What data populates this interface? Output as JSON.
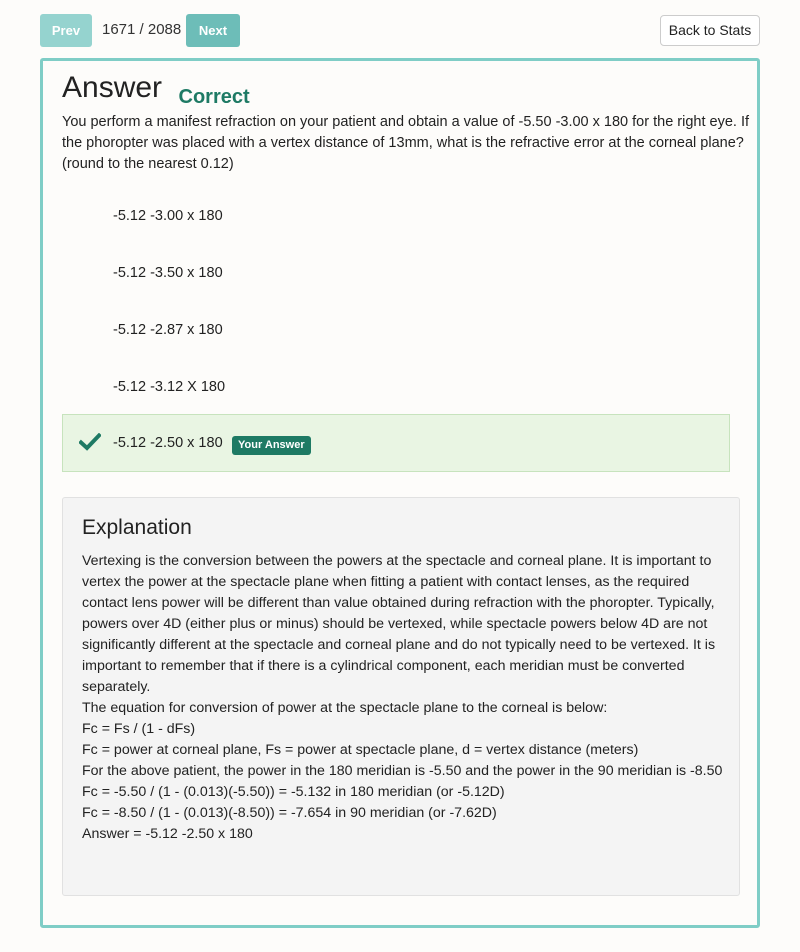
{
  "nav": {
    "prev_label": "Prev",
    "counter": "1671 / 2088",
    "next_label": "Next",
    "back_label": "Back to Stats"
  },
  "card": {
    "title": "Answer",
    "status": "Correct",
    "status_color": "#1e7a64",
    "border_color": "#7fcdc6",
    "question": "You perform a manifest refraction on your patient and obtain a value of -5.50 -3.00 x 180 for the right eye. If the phoropter was placed with a vertex distance of 13mm, what is the refractive error at the corneal plane? (round to the nearest 0.12)",
    "options": [
      "-5.12 -3.00 x 180",
      "-5.12 -3.50 x 180",
      "-5.12 -2.87 x 180",
      "-5.12 -3.12 X 180"
    ],
    "selected_option": "-5.12 -2.50 x 180",
    "selected_icon": "checkmark-icon",
    "your_answer_badge": "Your Answer"
  },
  "explanation": {
    "title": "Explanation",
    "lines": [
      "Vertexing is the conversion between the powers at the spectacle and corneal plane. It is important to vertex the power at the spectacle plane when fitting a patient with contact lenses, as the required contact lens power will be different than value obtained during refraction with the phoropter. Typically, powers over 4D (either plus or minus) should be vertexed, while spectacle powers below 4D are not significantly different at the spectacle and corneal plane and do not typically need to be vertexed. It is important to remember that if there is a cylindrical component, each meridian must be converted separately.",
      "The equation for conversion of power at the spectacle plane to the corneal is below:",
      "Fc = Fs / (1 - dFs)",
      "Fc = power at corneal plane, Fs = power at spectacle plane, d = vertex distance (meters)",
      "For the above patient, the power in the 180 meridian is -5.50 and the power in the 90 meridian is -8.50",
      "Fc = -5.50 / (1 - (0.013)(-5.50)) = -5.132 in 180 meridian (or -5.12D)",
      "Fc = -8.50 / (1 - (0.013)(-8.50)) = -7.654 in 90 meridian (or -7.62D)",
      "Answer = -5.12 -2.50 x 180"
    ]
  }
}
